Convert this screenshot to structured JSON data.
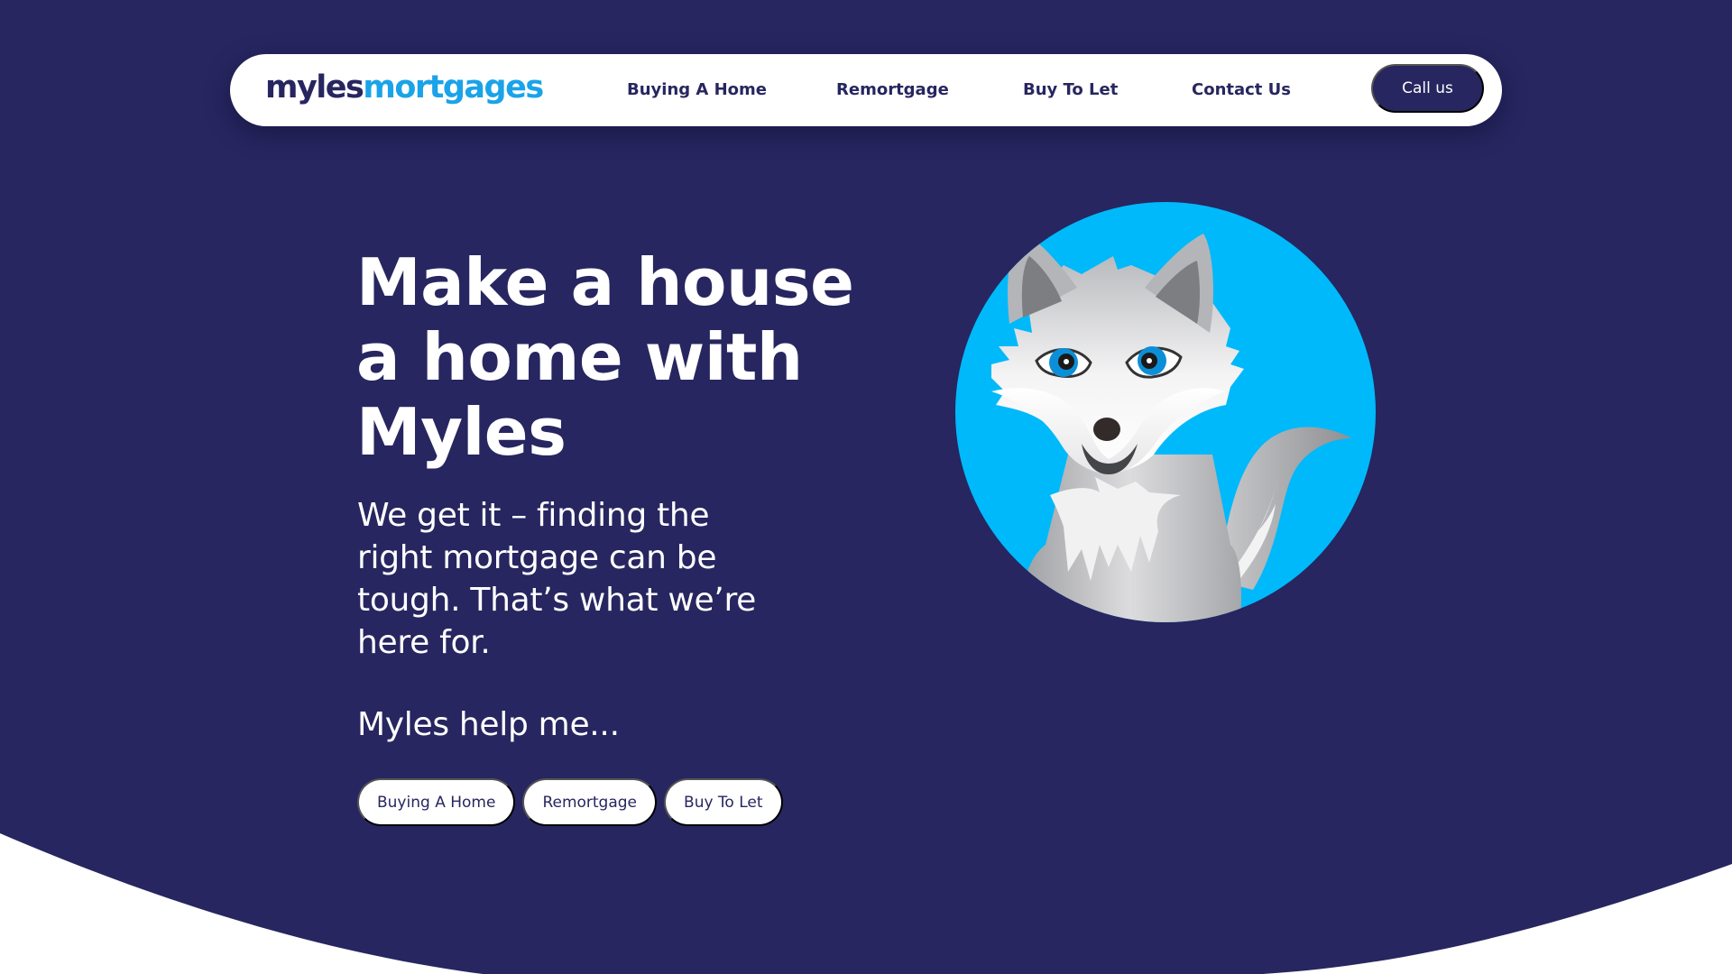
{
  "colors": {
    "navy": "#272660",
    "brand_blue": "#1aa3e8",
    "circle_blue": "#00b9fb",
    "white": "#ffffff"
  },
  "header": {
    "logo": {
      "part1": "myles",
      "part2": "mortgages"
    },
    "nav": [
      {
        "label": "Buying A Home"
      },
      {
        "label": "Remortgage"
      },
      {
        "label": "Buy To Let"
      },
      {
        "label": "Contact Us"
      }
    ],
    "cta_label": "Call us"
  },
  "hero": {
    "headline_lines": [
      "Make a house",
      "a home with",
      "Myles"
    ],
    "subtext_lines": [
      "We get it – finding the",
      "right mortgage can be",
      "tough. That’s what we’re",
      "here for."
    ],
    "help_label": "Myles help me...",
    "quick_links": [
      {
        "label": "Buying A Home"
      },
      {
        "label": "Remortgage"
      },
      {
        "label": "Buy To Let"
      }
    ],
    "mascot": {
      "icon": "fox-mascot-icon",
      "description": "Grey cartoon fox with blue eyes in a blue circle"
    }
  }
}
